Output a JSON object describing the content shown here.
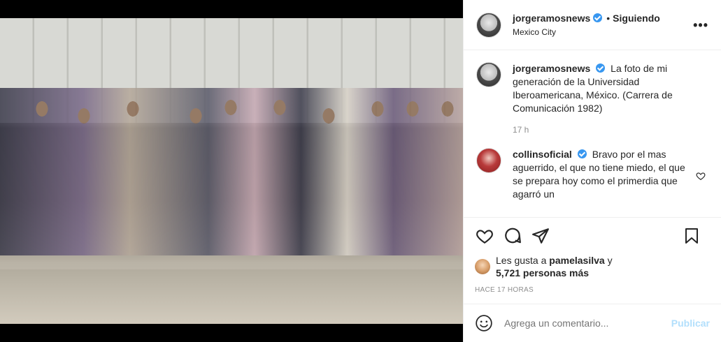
{
  "header": {
    "username": "jorgeramosnews",
    "separator": "•",
    "follow_status": "Siguiendo",
    "location": "Mexico City",
    "more_label": "•••"
  },
  "caption": {
    "username": "jorgeramosnews",
    "text": "La foto de mi generación de la Universidad Iberoamericana, México. (Carrera de Comunicación 1982)",
    "time": "17 h"
  },
  "comments": [
    {
      "username": "collinsoficial",
      "text": "Bravo por el mas aguerrido, el que no tiene miedo, el que se prepara hoy como el primerdia que agarró un"
    }
  ],
  "likes": {
    "prefix": "Les gusta a",
    "user": "pamelasilva",
    "connector": "y",
    "others": "5,721 personas más"
  },
  "posted_ago": "HACE 17 HORAS",
  "comment_box": {
    "placeholder": "Agrega un comentario...",
    "publish_label": "Publicar"
  },
  "icons": {
    "like": "heart-icon",
    "comment": "comment-icon",
    "share": "share-icon",
    "save": "bookmark-icon",
    "emoji": "emoji-icon",
    "verified": "verified-badge-icon"
  },
  "colors": {
    "verified": "#3897f0",
    "publish_disabled": "#b2dffc",
    "muted_text": "#8e8e8e"
  }
}
